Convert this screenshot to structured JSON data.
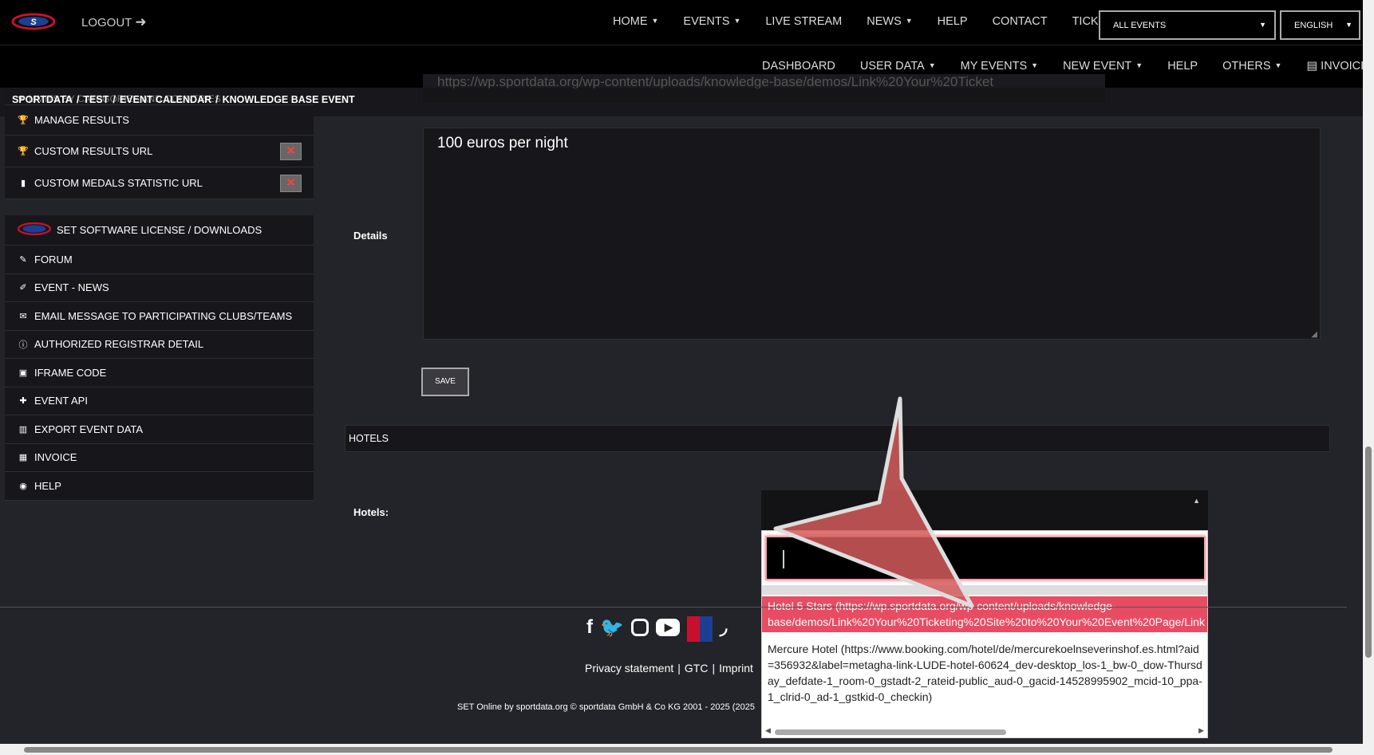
{
  "header": {
    "logout_label": "LOGOUT",
    "nav": [
      {
        "label": "HOME",
        "caret": true
      },
      {
        "label": "EVENTS",
        "caret": true
      },
      {
        "label": "LIVE STREAM",
        "caret": false
      },
      {
        "label": "NEWS",
        "caret": true
      },
      {
        "label": "HELP",
        "caret": false
      },
      {
        "label": "CONTACT",
        "caret": false
      },
      {
        "label": "TICKETS",
        "caret": false
      }
    ],
    "events_select": "ALL EVENTS",
    "language_select": "ENGLISH",
    "subnav": [
      {
        "label": "DASHBOARD",
        "caret": false
      },
      {
        "label": "USER DATA",
        "caret": true
      },
      {
        "label": "MY EVENTS",
        "caret": true
      },
      {
        "label": "NEW EVENT",
        "caret": true
      },
      {
        "label": "HELP",
        "caret": false
      },
      {
        "label": "OTHERS",
        "caret": true
      },
      {
        "label": "INVOICING",
        "caret": true
      }
    ]
  },
  "breadcrumb": [
    "SPORTDATA",
    "TEST",
    "EVENT CALENDAR",
    "KNOWLEDGE BASE EVENT"
  ],
  "breadcrumb_sep": "/",
  "sidebar": {
    "partial_item": "LIMITS BY CATEGORIES AND COUNTRIES",
    "group1": [
      {
        "label": "MANAGE RESULTS",
        "icon": "trophy-icon",
        "delete": false
      },
      {
        "label": "CUSTOM RESULTS URL",
        "icon": "trophy-icon",
        "delete": true
      },
      {
        "label": "CUSTOM MEDALS STATISTIC URL",
        "icon": "bar-chart-icon",
        "delete": true
      }
    ],
    "group2": [
      {
        "label": "SET SOFTWARE LICENSE / DOWNLOADS",
        "icon": "set-logo-icon"
      },
      {
        "label": "FORUM",
        "icon": "forum-icon"
      },
      {
        "label": "EVENT - NEWS",
        "icon": "news-icon"
      },
      {
        "label": "EMAIL MESSAGE TO PARTICIPATING CLUBS/TEAMS",
        "icon": "envelope-icon"
      },
      {
        "label": "AUTHORIZED REGISTRAR DETAIL",
        "icon": "info-icon"
      },
      {
        "label": "IFRAME CODE",
        "icon": "code-icon"
      },
      {
        "label": "EVENT API",
        "icon": "puzzle-icon"
      },
      {
        "label": "EXPORT EVENT DATA",
        "icon": "export-icon"
      },
      {
        "label": "INVOICE",
        "icon": "invoice-icon"
      },
      {
        "label": "HELP",
        "icon": "help-globe-icon"
      }
    ]
  },
  "main": {
    "ghost_url": "https://wp.sportdata.org/wp-content/uploads/knowledge-base/demos/Link%20Your%20Ticket",
    "details_label": "Details",
    "details_value": "100 euros per night",
    "save_label": "SAVE",
    "hotels_heading": "HOTELS",
    "hotels_label": "Hotels:"
  },
  "dropdown": {
    "search_value": "",
    "options": [
      {
        "text": "Hotel 5 Stars (https://wp.sportdata.org/wp-content/uploads/knowledge-base/demos/Link%20Your%20Ticketing%20Site%20to%20Your%20Event%20Page/Link",
        "highlighted": true
      },
      {
        "text": "Mercure Hotel (https://www.booking.com/hotel/de/mercurekoelnseverinshof.es.html?aid=356932&label=metagha-link-LUDE-hotel-60624_dev-desktop_los-1_bw-0_dow-Thursday_defdate-1_room-0_gstadt-2_rateid-public_aud-0_gacid-14528995902_mcid-10_ppa-1_clrid-0_ad-1_gstkid-0_checkin)",
        "highlighted": false
      }
    ]
  },
  "footer": {
    "social_icons": [
      "facebook-icon",
      "twitter-icon",
      "instagram-icon",
      "youtube-icon",
      "sportdata-icon",
      "rss-icon"
    ],
    "links": [
      "Privacy statement",
      "GTC",
      "Imprint"
    ],
    "link_sep": "|",
    "copyright": "SET Online by sportdata.org © sportdata GmbH & Co KG 2001 - 2025 (2025"
  },
  "colors": {
    "highlight": "#e84c63",
    "header_bg": "#000000",
    "page_bg": "#23232a",
    "danger_x": "#ff4040"
  }
}
